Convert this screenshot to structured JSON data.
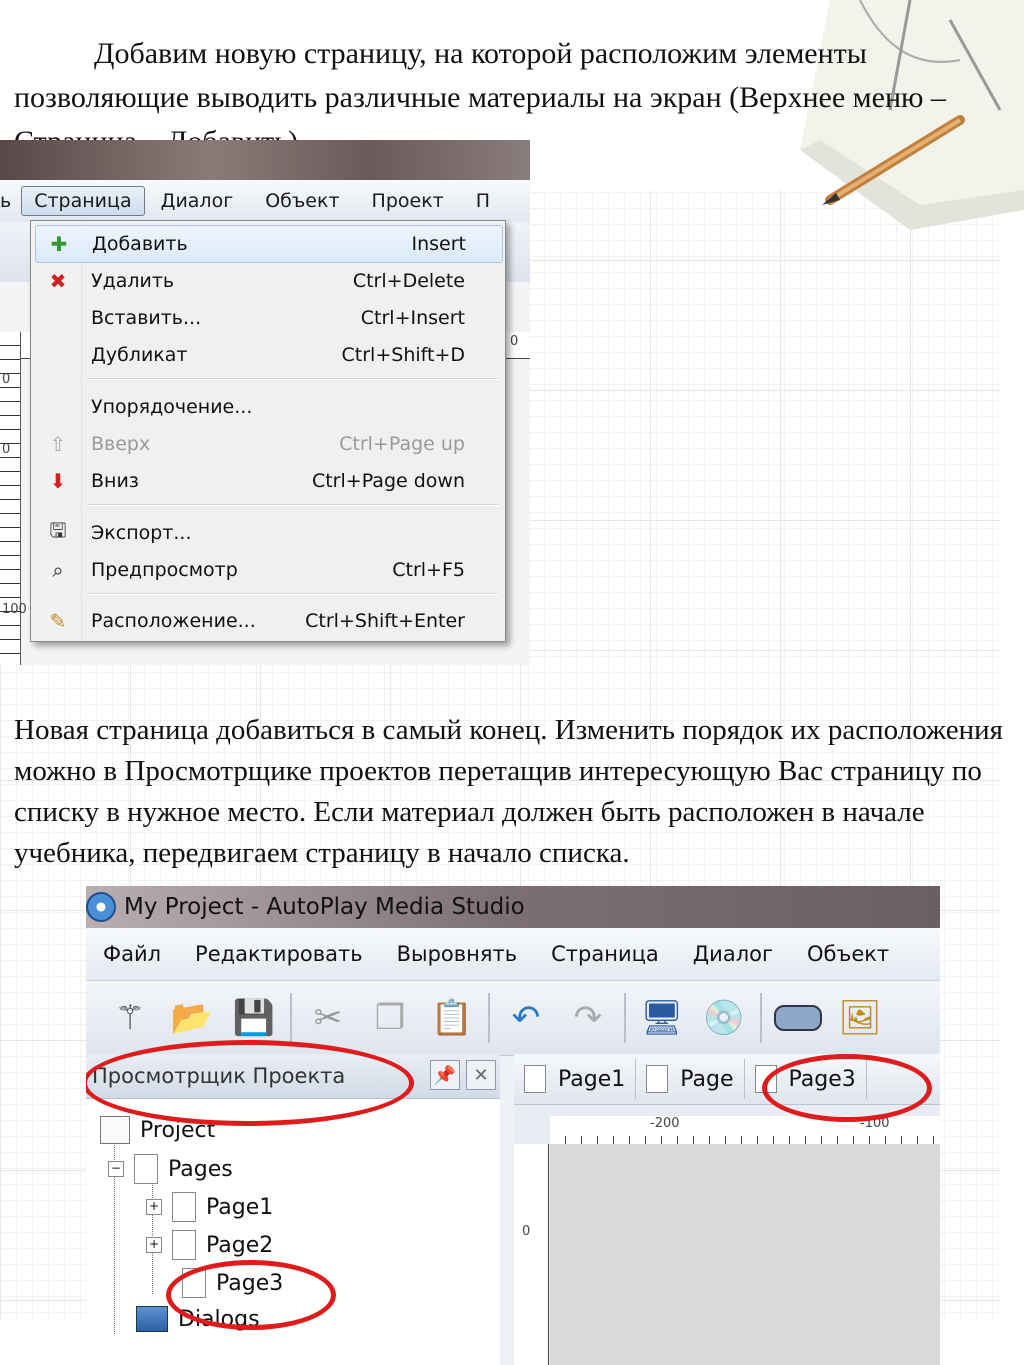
{
  "text": {
    "paragraph1": "Добавим новую страницу, на которой расположим элементы позволяющие выводить различные материалы на экран (Верхнее меню – Страница – Добавить).",
    "paragraph2": "Новая страница добавиться в самый конец. Изменить порядок  их расположения можно в Просмотрщике проектов перетащив интересующую Вас страницу по списку в нужное место. Если материал должен быть расположен в начале учебника, передвигаем страницу в начало списка."
  },
  "menu_shot": {
    "menubar": [
      "ь",
      "Страница",
      "Диалог",
      "Объект",
      "Проект",
      "П"
    ],
    "items": [
      {
        "label": "Добавить",
        "shortcut": "Insert",
        "icon": "add-page-icon"
      },
      {
        "label": "Удалить",
        "shortcut": "Ctrl+Delete",
        "icon": "delete-page-icon"
      },
      {
        "label": "Вставить...",
        "shortcut": "Ctrl+Insert",
        "icon": ""
      },
      {
        "label": "Дубликат",
        "shortcut": "Ctrl+Shift+D",
        "icon": ""
      },
      {
        "label": "Упорядочение...",
        "shortcut": "",
        "icon": ""
      },
      {
        "label": "Вверх",
        "shortcut": "Ctrl+Page up",
        "icon": "arrow-up-icon"
      },
      {
        "label": "Вниз",
        "shortcut": "Ctrl+Page down",
        "icon": "arrow-down-icon"
      },
      {
        "label": "Экспорт...",
        "shortcut": "",
        "icon": "export-icon"
      },
      {
        "label": "Предпросмотр",
        "shortcut": "Ctrl+F5",
        "icon": "preview-icon"
      },
      {
        "label": "Расположение...",
        "shortcut": "Ctrl+Shift+Enter",
        "icon": "properties-icon"
      }
    ],
    "ruler_labels": [
      "0",
      "0",
      "0",
      "100"
    ]
  },
  "app_shot": {
    "title": "My Project - AutoPlay Media Studio",
    "menubar": [
      "Файл",
      "Редактировать",
      "Выровнять",
      "Страница",
      "Диалог",
      "Объект"
    ],
    "panel_title": "Просмотрщик Проекта",
    "tree": {
      "root": "Project",
      "pages": "Pages",
      "page1": "Page1",
      "page2": "Page2",
      "page3": "Page3",
      "dialogs": "Dialogs"
    },
    "tabs": [
      "Page1",
      "Page",
      "Page3"
    ],
    "ruler": [
      "-200",
      "-100",
      "0"
    ]
  },
  "colors": {
    "highlight_ellipse": "#e01b1b"
  }
}
